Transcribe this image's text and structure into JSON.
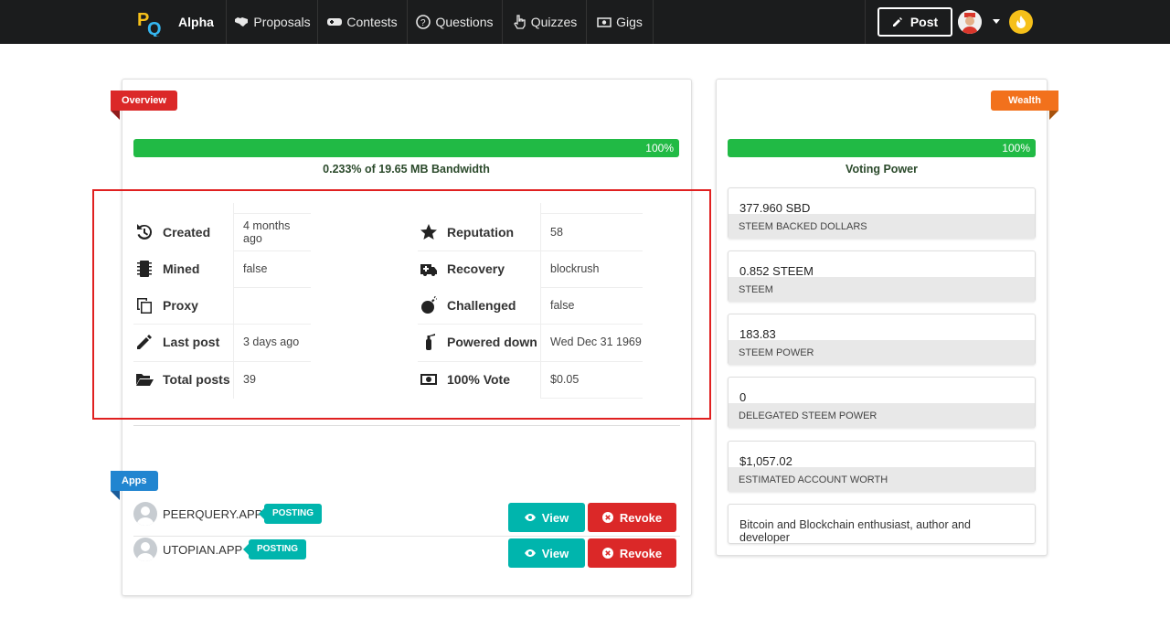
{
  "nav": {
    "brand": "Alpha",
    "items": [
      {
        "label": "Proposals"
      },
      {
        "label": "Contests"
      },
      {
        "label": "Questions"
      },
      {
        "label": "Quizzes"
      },
      {
        "label": "Gigs"
      }
    ],
    "post_label": "Post"
  },
  "overview": {
    "ribbon": "Overview",
    "bandwidth_percent_label": "100%",
    "bandwidth_percent": 100,
    "bandwidth_label": "0.233% of 19.65 MB Bandwidth",
    "left_rows": [
      {
        "icon": "history-icon",
        "label": "Created",
        "value": "4 months ago"
      },
      {
        "icon": "microchip-icon",
        "label": "Mined",
        "value": "false"
      },
      {
        "icon": "copy-icon",
        "label": "Proxy",
        "value": ""
      },
      {
        "icon": "pencil-icon",
        "label": "Last post",
        "value": "3 days ago"
      },
      {
        "icon": "folder-open-icon",
        "label": "Total posts",
        "value": "39"
      }
    ],
    "right_rows": [
      {
        "icon": "star-icon",
        "label": "Reputation",
        "value": "58"
      },
      {
        "icon": "ambulance-icon",
        "label": "Recovery",
        "value": "blockrush"
      },
      {
        "icon": "bomb-icon",
        "label": "Challenged",
        "value": "false"
      },
      {
        "icon": "fire-extinguisher-icon",
        "label": "Powered down",
        "value": "Wed Dec 31 1969"
      },
      {
        "icon": "money-icon",
        "label": "100% Vote",
        "value": "$0.05"
      }
    ]
  },
  "apps": {
    "ribbon": "Apps",
    "items": [
      {
        "name": "PEERQUERY.APP",
        "tag": "POSTING",
        "view_label": "View",
        "revoke_label": "Revoke"
      },
      {
        "name": "UTOPIAN.APP",
        "tag": "POSTING",
        "view_label": "View",
        "revoke_label": "Revoke"
      }
    ]
  },
  "wealth": {
    "ribbon": "Wealth",
    "voting_percent_label": "100%",
    "voting_percent": 100,
    "voting_label": "Voting Power",
    "stats": [
      {
        "value": "377.960 SBD",
        "label": "STEEM BACKED DOLLARS"
      },
      {
        "value": "0.852 STEEM",
        "label": "STEEM"
      },
      {
        "value": "183.83",
        "label": "STEEM POWER"
      },
      {
        "value": "0",
        "label": "DELEGATED STEEM POWER"
      },
      {
        "value": "$1,057.02",
        "label": "ESTIMATED ACCOUNT WORTH"
      }
    ],
    "about": "Bitcoin and Blockchain enthusiast, author and developer"
  },
  "colors": {
    "navbar": "#1b1c1d",
    "overview_ribbon": "#db2828",
    "wealth_ribbon": "#f2711c",
    "apps_ribbon": "#2185d0",
    "progress": "#21ba45",
    "teal": "#00b5ad",
    "red": "#db2828"
  }
}
